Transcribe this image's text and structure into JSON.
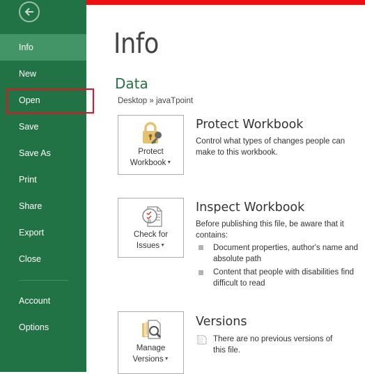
{
  "sidebar": {
    "back_icon": "back-arrow-icon",
    "items": [
      {
        "label": "Info",
        "active": true
      },
      {
        "label": "New"
      },
      {
        "label": "Open",
        "highlighted": true
      },
      {
        "label": "Save"
      },
      {
        "label": "Save As"
      },
      {
        "label": "Print"
      },
      {
        "label": "Share"
      },
      {
        "label": "Export"
      },
      {
        "label": "Close"
      },
      {
        "label": "Account"
      },
      {
        "label": "Options"
      }
    ]
  },
  "colors": {
    "sidebar_bg": "#217346",
    "sidebar_active": "#439467",
    "accent_green": "#217346",
    "highlight_red": "#e81123",
    "top_bar_red": "#ec1010"
  },
  "main": {
    "title": "Info",
    "section": "Data",
    "path": "Desktop » javaTpoint",
    "blocks": [
      {
        "button_line1": "Protect",
        "button_line2": "Workbook",
        "icon": "lock-key-icon",
        "title": "Protect Workbook",
        "description": "Control what types of changes people can make to this workbook."
      },
      {
        "button_line1": "Check for",
        "button_line2": "Issues",
        "icon": "inspect-document-icon",
        "title": "Inspect Workbook",
        "description": "Before publishing this file, be aware that it contains:",
        "bullets": [
          "Document properties, author's name and absolute path",
          "Content that people with disabilities find difficult to read"
        ]
      },
      {
        "button_line1": "Manage",
        "button_line2": "Versions",
        "icon": "manage-versions-icon",
        "title": "Versions",
        "description": "There are no previous versions of this file."
      }
    ]
  }
}
